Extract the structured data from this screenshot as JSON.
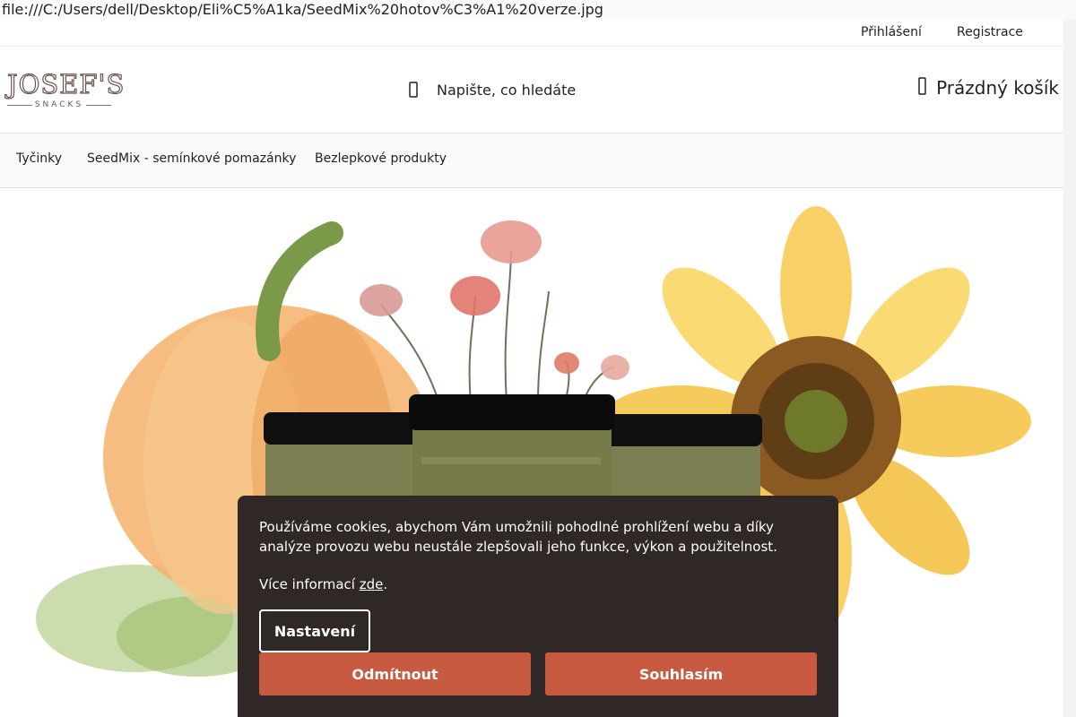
{
  "browser": {
    "url": "file:///C:/Users/dell/Desktop/Eli%C5%A1ka/SeedMix%20hotov%C3%A1%20verze.jpg"
  },
  "topbar": {
    "login": "Přihlášení",
    "register": "Registrace"
  },
  "logo": {
    "main": "JOSEF'S",
    "sub": "SNACKS"
  },
  "search": {
    "placeholder": "Napište, co hledáte",
    "icon": "search-icon"
  },
  "cart": {
    "label": "Prázdný košík",
    "icon": "cart-icon"
  },
  "nav": {
    "items": [
      {
        "label": "Tyčinky"
      },
      {
        "label": "SeedMix - semínkové pomazánky"
      },
      {
        "label": "Bezlepkové produkty"
      }
    ]
  },
  "cookie": {
    "text": "Používáme cookies, abychom Vám umožnili pohodlné prohlížení webu a díky analýze provozu webu neustále zlepšovali jeho funkce, výkon a použitelnost.",
    "more_prefix": "Více informací ",
    "more_link": "zde",
    "more_suffix": ".",
    "settings_label": "Nastavení",
    "reject_label": "Odmítnout",
    "accept_label": "Souhlasím",
    "button_color": "#c85a42",
    "panel_color": "#2f2826"
  }
}
